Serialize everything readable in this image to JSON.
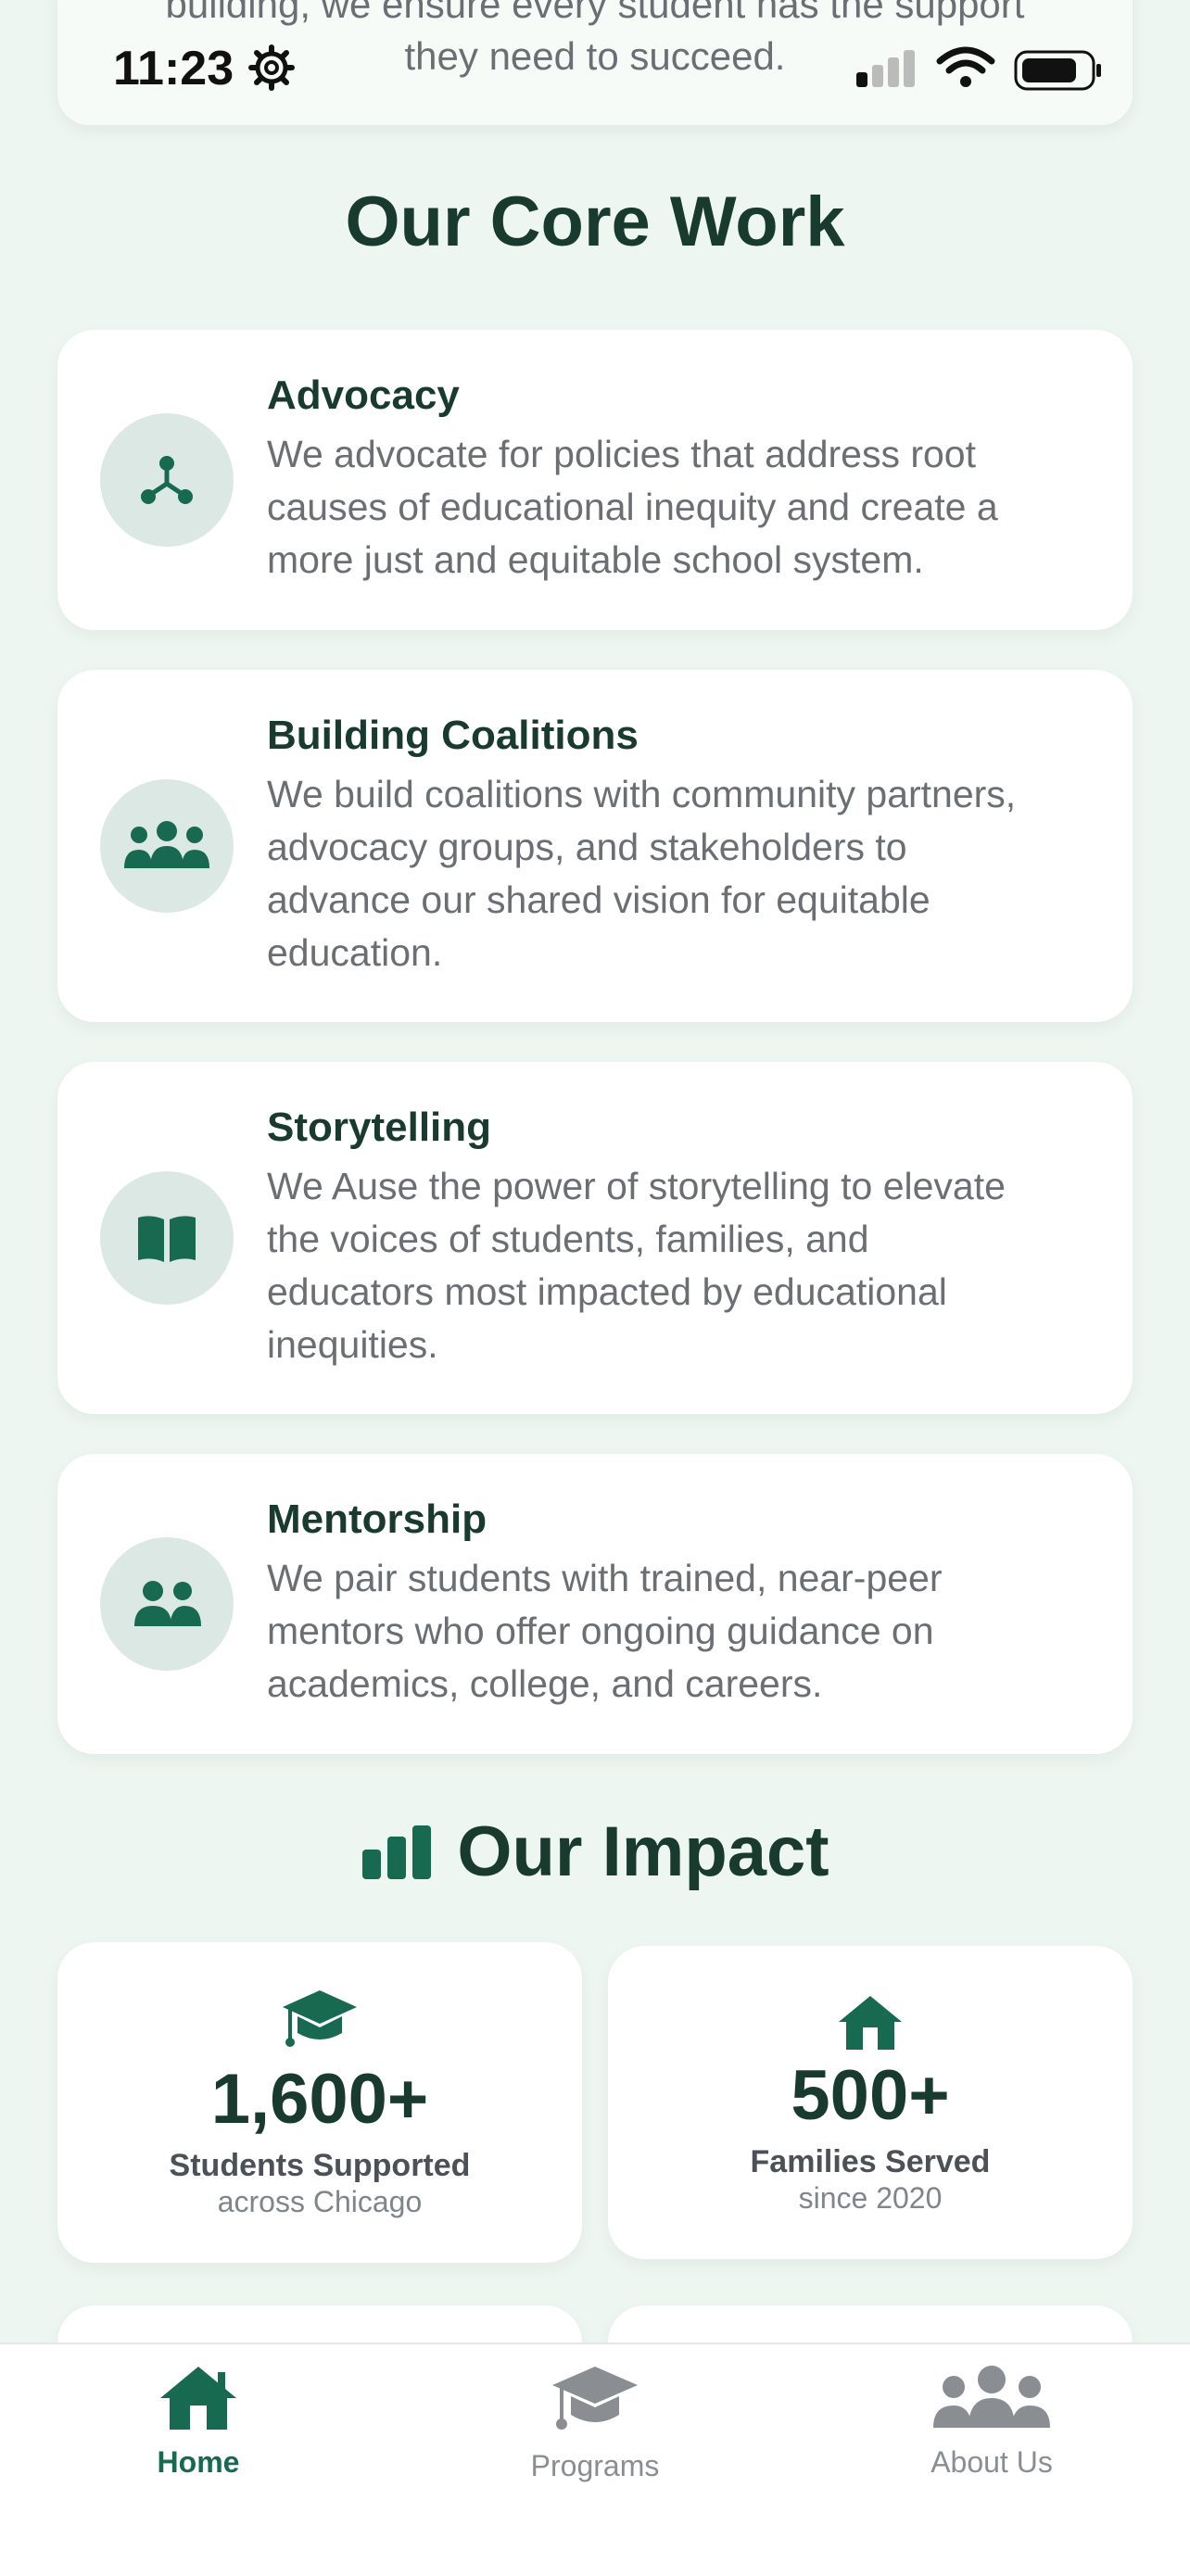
{
  "status_bar": {
    "time": "11:23"
  },
  "intro": {
    "line1": "building, we ensure every student has the support",
    "line2": "they need to succeed."
  },
  "core_work": {
    "title": "Our Core Work",
    "items": [
      {
        "icon": "network-icon",
        "title": "Advocacy",
        "line1": "We advocate for policies that address root",
        "line2": "causes of educational inequity and create a",
        "line3": "more just and equitable school system.",
        "line4": ""
      },
      {
        "icon": "people-group-icon",
        "title": "Building Coalitions",
        "line1": "We build coalitions with community partners,",
        "line2": "advocacy groups, and stakeholders to",
        "line3": "advance our shared vision for equitable",
        "line4": "education."
      },
      {
        "icon": "book-open-icon",
        "title": "Storytelling",
        "line1": "We Ause the power of storytelling to elevate",
        "line2": "the voices of students, families, and",
        "line3": "educators most impacted by educational",
        "line4": "inequities."
      },
      {
        "icon": "user-pair-icon",
        "title": "Mentorship",
        "line1": "We pair students with trained, near-peer",
        "line2": "mentors who offer ongoing guidance on",
        "line3": "academics, college, and careers.",
        "line4": ""
      }
    ]
  },
  "impact": {
    "title": "Our Impact",
    "stats": [
      {
        "icon": "graduation-cap-icon",
        "number": "1,600+",
        "label": "Students Supported",
        "sub": "across Chicago"
      },
      {
        "icon": "house-icon",
        "number": "500+",
        "label": "Families Served",
        "sub": "since 2020"
      }
    ]
  },
  "tabbar": {
    "tabs": [
      {
        "label": "Home",
        "icon": "home-icon",
        "active": true
      },
      {
        "label": "Programs",
        "icon": "graduation-cap-icon",
        "active": false
      },
      {
        "label": "About Us",
        "icon": "users-icon",
        "active": false
      }
    ]
  },
  "colors": {
    "accent": "#17694f",
    "heading": "#183a2f",
    "background": "#eef6f2",
    "icon_bg": "#dce8e3"
  }
}
